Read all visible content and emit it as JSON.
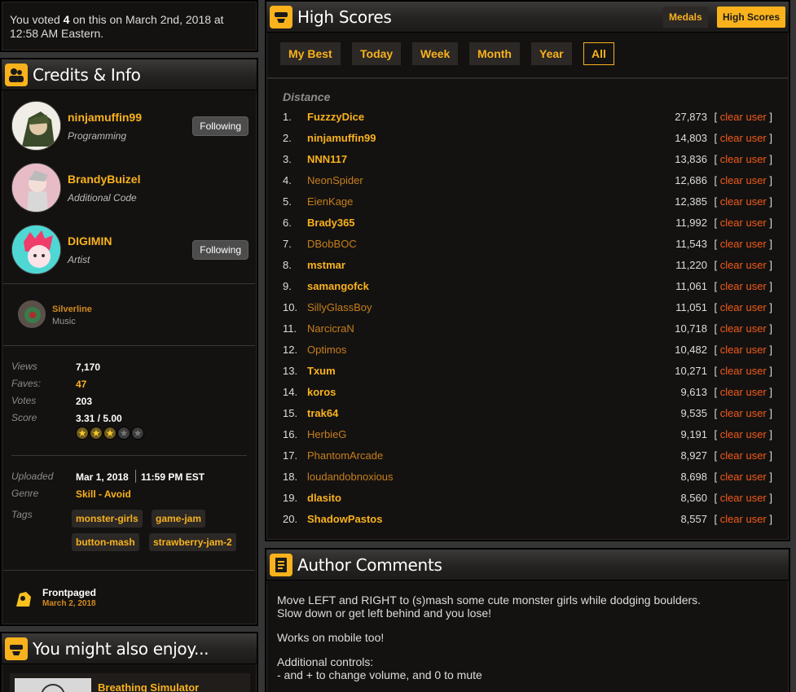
{
  "vote": {
    "prefix": "You voted ",
    "score": "4",
    "suffix": " on this on March 2nd, 2018 at",
    "line2": "12:58 AM Eastern."
  },
  "credits": {
    "title": "Credits & Info",
    "people": [
      {
        "name": "ninjamuffin99",
        "role": "Programming",
        "follow": "Following"
      },
      {
        "name": "BrandyBuizel",
        "role": "Additional Code",
        "follow": ""
      },
      {
        "name": "DIGIMIN",
        "role": "Artist",
        "follow": "Following"
      }
    ],
    "extra": {
      "name": "Silverline",
      "role": "Music"
    },
    "stats": {
      "views_label": "Views",
      "views": "7,170",
      "faves_label": "Faves:",
      "faves": "47",
      "votes_label": "Votes",
      "votes": "203",
      "score_label": "Score",
      "score": "3.31 / 5.00",
      "stars_on": 3,
      "stars_total": 5
    },
    "meta": {
      "uploaded_label": "Uploaded",
      "uploaded_date": "Mar 1, 2018",
      "uploaded_time": "11:59 PM EST",
      "genre_label": "Genre",
      "genre": "Skill - Avoid",
      "tags_label": "Tags",
      "tags": [
        "monster-girls",
        "game-jam",
        "button-mash",
        "strawberry-jam-2"
      ]
    },
    "frontpaged": {
      "label": "Frontpaged",
      "date": "March 2, 2018"
    }
  },
  "enjoy": {
    "title": "You might also enjoy...",
    "item_title": "Breathing Simulator"
  },
  "scores": {
    "title": "High Scores",
    "medals_label": "Medals",
    "hs_label": "High Scores",
    "tabs": [
      "My Best",
      "Today",
      "Week",
      "Month",
      "Year",
      "All"
    ],
    "active_tab": "All",
    "category": "Distance",
    "clear_label": "clear user",
    "rows": [
      {
        "rank": "1.",
        "user": "FuzzzyDice",
        "value": "27,873",
        "supporter": true
      },
      {
        "rank": "2.",
        "user": "ninjamuffin99",
        "value": "14,803",
        "supporter": true
      },
      {
        "rank": "3.",
        "user": "NNN117",
        "value": "13,836",
        "supporter": true
      },
      {
        "rank": "4.",
        "user": "NeonSpider",
        "value": "12,686",
        "supporter": false
      },
      {
        "rank": "5.",
        "user": "EienKage",
        "value": "12,385",
        "supporter": false
      },
      {
        "rank": "6.",
        "user": "Brady365",
        "value": "11,992",
        "supporter": true
      },
      {
        "rank": "7.",
        "user": "DBobBOC",
        "value": "11,543",
        "supporter": false
      },
      {
        "rank": "8.",
        "user": "mstmar",
        "value": "11,220",
        "supporter": true
      },
      {
        "rank": "9.",
        "user": "samangofck",
        "value": "11,061",
        "supporter": true
      },
      {
        "rank": "10.",
        "user": "SillyGlassBoy",
        "value": "11,051",
        "supporter": false
      },
      {
        "rank": "11.",
        "user": "NarcicraN",
        "value": "10,718",
        "supporter": false
      },
      {
        "rank": "12.",
        "user": "Optimos",
        "value": "10,482",
        "supporter": false
      },
      {
        "rank": "13.",
        "user": "Txum",
        "value": "10,271",
        "supporter": true
      },
      {
        "rank": "14.",
        "user": "koros",
        "value": "9,613",
        "supporter": true
      },
      {
        "rank": "15.",
        "user": "trak64",
        "value": "9,535",
        "supporter": true
      },
      {
        "rank": "16.",
        "user": "HerbieG",
        "value": "9,191",
        "supporter": false
      },
      {
        "rank": "17.",
        "user": "PhantomArcade",
        "value": "8,927",
        "supporter": false
      },
      {
        "rank": "18.",
        "user": "loudandobnoxious",
        "value": "8,698",
        "supporter": false
      },
      {
        "rank": "19.",
        "user": "dlasito",
        "value": "8,560",
        "supporter": true
      },
      {
        "rank": "20.",
        "user": "ShadowPastos",
        "value": "8,557",
        "supporter": true
      }
    ]
  },
  "comments": {
    "title": "Author Comments",
    "paragraphs": [
      "Move LEFT and RIGHT to (s)mash some cute monster girls while dodging boulders.\nSlow down or get left behind and you lose!",
      "Works on mobile too!",
      "Additional controls:\n- and + to change volume, and 0 to mute"
    ]
  },
  "colors": {
    "accent": "#f9b21c",
    "clear": "#f05a1a",
    "panel": "#141211",
    "bg": "#353535"
  }
}
